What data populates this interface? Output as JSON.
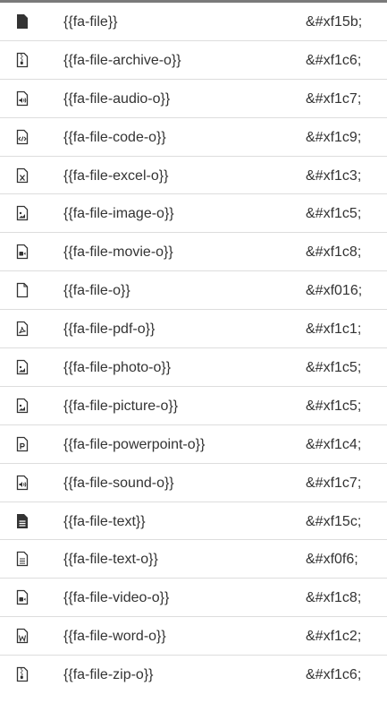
{
  "rows": [
    {
      "icon": "file-icon",
      "name": "{{fa-file}}",
      "code": "&#xf15b;"
    },
    {
      "icon": "file-archive-o-icon",
      "name": "{{fa-file-archive-o}}",
      "code": "&#xf1c6;"
    },
    {
      "icon": "file-audio-o-icon",
      "name": "{{fa-file-audio-o}}",
      "code": "&#xf1c7;"
    },
    {
      "icon": "file-code-o-icon",
      "name": "{{fa-file-code-o}}",
      "code": "&#xf1c9;"
    },
    {
      "icon": "file-excel-o-icon",
      "name": "{{fa-file-excel-o}}",
      "code": "&#xf1c3;"
    },
    {
      "icon": "file-image-o-icon",
      "name": "{{fa-file-image-o}}",
      "code": "&#xf1c5;"
    },
    {
      "icon": "file-movie-o-icon",
      "name": "{{fa-file-movie-o}}",
      "code": "&#xf1c8;"
    },
    {
      "icon": "file-o-icon",
      "name": "{{fa-file-o}}",
      "code": "&#xf016;"
    },
    {
      "icon": "file-pdf-o-icon",
      "name": "{{fa-file-pdf-o}}",
      "code": "&#xf1c1;"
    },
    {
      "icon": "file-photo-o-icon",
      "name": "{{fa-file-photo-o}}",
      "code": "&#xf1c5;"
    },
    {
      "icon": "file-picture-o-icon",
      "name": "{{fa-file-picture-o}}",
      "code": "&#xf1c5;"
    },
    {
      "icon": "file-powerpoint-o-icon",
      "name": "{{fa-file-powerpoint-o}}",
      "code": "&#xf1c4;"
    },
    {
      "icon": "file-sound-o-icon",
      "name": "{{fa-file-sound-o}}",
      "code": "&#xf1c7;"
    },
    {
      "icon": "file-text-icon",
      "name": "{{fa-file-text}}",
      "code": "&#xf15c;"
    },
    {
      "icon": "file-text-o-icon",
      "name": "{{fa-file-text-o}}",
      "code": "&#xf0f6;"
    },
    {
      "icon": "file-video-o-icon",
      "name": "{{fa-file-video-o}}",
      "code": "&#xf1c8;"
    },
    {
      "icon": "file-word-o-icon",
      "name": "{{fa-file-word-o}}",
      "code": "&#xf1c2;"
    },
    {
      "icon": "file-zip-o-icon",
      "name": "{{fa-file-zip-o}}",
      "code": "&#xf1c6;"
    }
  ]
}
